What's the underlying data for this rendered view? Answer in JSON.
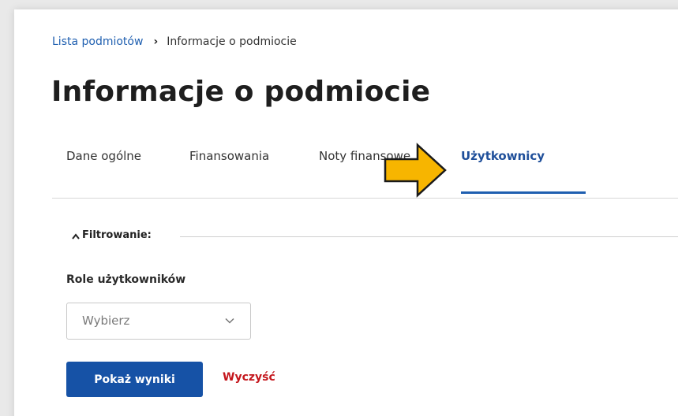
{
  "breadcrumb": {
    "parent": "Lista podmiotów",
    "separator": "›",
    "current": "Informacje o podmiocie"
  },
  "page": {
    "title": "Informacje o podmiocie"
  },
  "tabs": [
    {
      "label": "Dane ogólne",
      "active": false
    },
    {
      "label": "Finansowania",
      "active": false
    },
    {
      "label": "Noty finansowe",
      "active": false
    },
    {
      "label": "Użytkownicy",
      "active": true
    }
  ],
  "filter": {
    "label": "Filtrowanie:",
    "icon": "chevron-up-icon",
    "role_label": "Role użytkowników",
    "role_select": {
      "value": "Wybierz",
      "icon": "chevron-down-icon"
    }
  },
  "actions": {
    "submit_label": "Pokaż wyniki",
    "clear_label": "Wyczyść"
  },
  "annotation": {
    "icon": "arrow-right-icon",
    "color": "#f7b500"
  },
  "colors": {
    "primary": "#1652a6",
    "link": "#1f5fb0",
    "danger": "#c4161c"
  }
}
